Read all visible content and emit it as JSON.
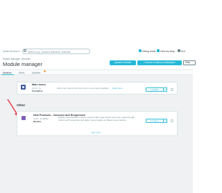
{
  "topbar": {
    "quick_access": "Quick Access ▾",
    "search_placeholder": "Search (e.g.: product reference, custome",
    "links": [
      "Debug mode",
      "View my shop",
      "Exit"
    ]
  },
  "header": {
    "breadcrumb": "Module Manager  /  Modules",
    "title": "Module manager",
    "upload_button": "Upload a module",
    "connect_button": "Connect to Addons marketplace",
    "help_button": "Help"
  },
  "tabs": [
    {
      "label": "Modules"
    },
    {
      "label": "Alerts"
    },
    {
      "label": "Updates"
    }
  ],
  "modules": {
    "main_menu": {
      "title": "Main menu",
      "version": "v3.1.0 · by",
      "author": "PrestaShop",
      "description": "Add a new menu to the top of your e-commerce website.",
      "read_more": "… Read more",
      "action": "Upgrade",
      "dropdown": "▾"
    },
    "section_title": "Other",
    "new_products": {
      "title": "New Products - Carousel and Responsive",
      "version": "v1.0.0 · by Buffon",
      "author": "Modules",
      "description": "Display new Products in Home page Product page bottom and every page left right column with responsive and slider. New products on Sliders new products.",
      "action": "Configure",
      "dropdown": "▾"
    },
    "see_more": "See more"
  },
  "colors": {
    "accent": "#25b9d7",
    "arrow": "#e5202e",
    "module_icon": "#3b5998"
  }
}
